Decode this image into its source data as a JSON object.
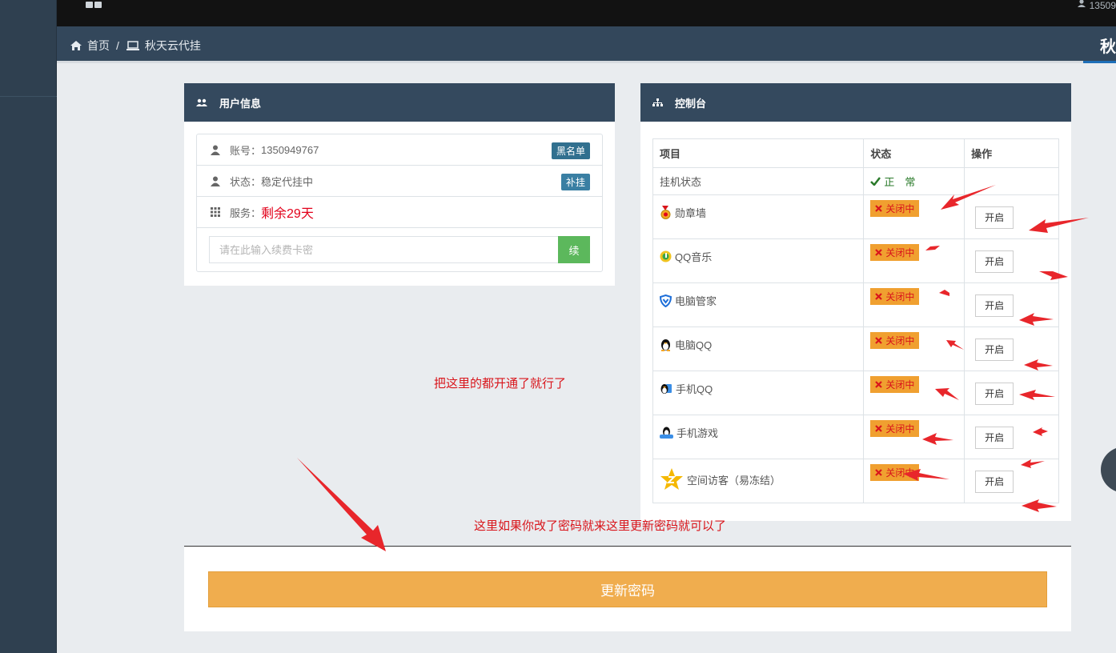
{
  "topbar": {
    "user_text": "13509"
  },
  "breadcrumb": {
    "home": "首页",
    "separator": "/",
    "current": "秋天云代挂",
    "right_title": "秋"
  },
  "user_panel": {
    "title": "用户信息",
    "account_label": "账号：",
    "account_value": "1350949767",
    "blacklist_badge": "黑名单",
    "status_label": "状态：",
    "status_value": "稳定代挂中",
    "supplement_badge": "补挂",
    "service_label": "服务：",
    "service_value": "剩余29天",
    "card_placeholder": "请在此输入续费卡密",
    "renew_button": "续"
  },
  "console_panel": {
    "title": "控制台",
    "headers": [
      "项目",
      "状态",
      "操作"
    ],
    "hang_row": {
      "label": "挂机状态",
      "status": "正　常"
    },
    "rows": [
      {
        "name": "勋章墙",
        "status": "关闭中",
        "action": "开启",
        "icon": "medal-icon"
      },
      {
        "name": "QQ音乐",
        "status": "关闭中",
        "action": "开启",
        "icon": "music-icon"
      },
      {
        "name": "电脑管家",
        "status": "关闭中",
        "action": "开启",
        "icon": "shield-icon"
      },
      {
        "name": "电脑QQ",
        "status": "关闭中",
        "action": "开启",
        "icon": "penguin-icon"
      },
      {
        "name": "手机QQ",
        "status": "关闭中",
        "action": "开启",
        "icon": "mobile-qq-icon"
      },
      {
        "name": "手机游戏",
        "status": "关闭中",
        "action": "开启",
        "icon": "game-icon"
      },
      {
        "name": "空间访客（易冻结）",
        "status": "关闭中",
        "action": "开启",
        "icon": "star-icon"
      }
    ]
  },
  "notes": {
    "note1": "把这里的都开通了就行了",
    "note2": "这里如果你改了密码就来这里更新密码就可以了"
  },
  "password_button": "更新密码",
  "colors": {
    "sidebar": "#2f4050",
    "panel_header": "#34495e",
    "renew_green": "#5cb85c",
    "status_off": "#f0a030",
    "password_button": "#f0ad4e",
    "annotation_red": "#e8262b"
  }
}
